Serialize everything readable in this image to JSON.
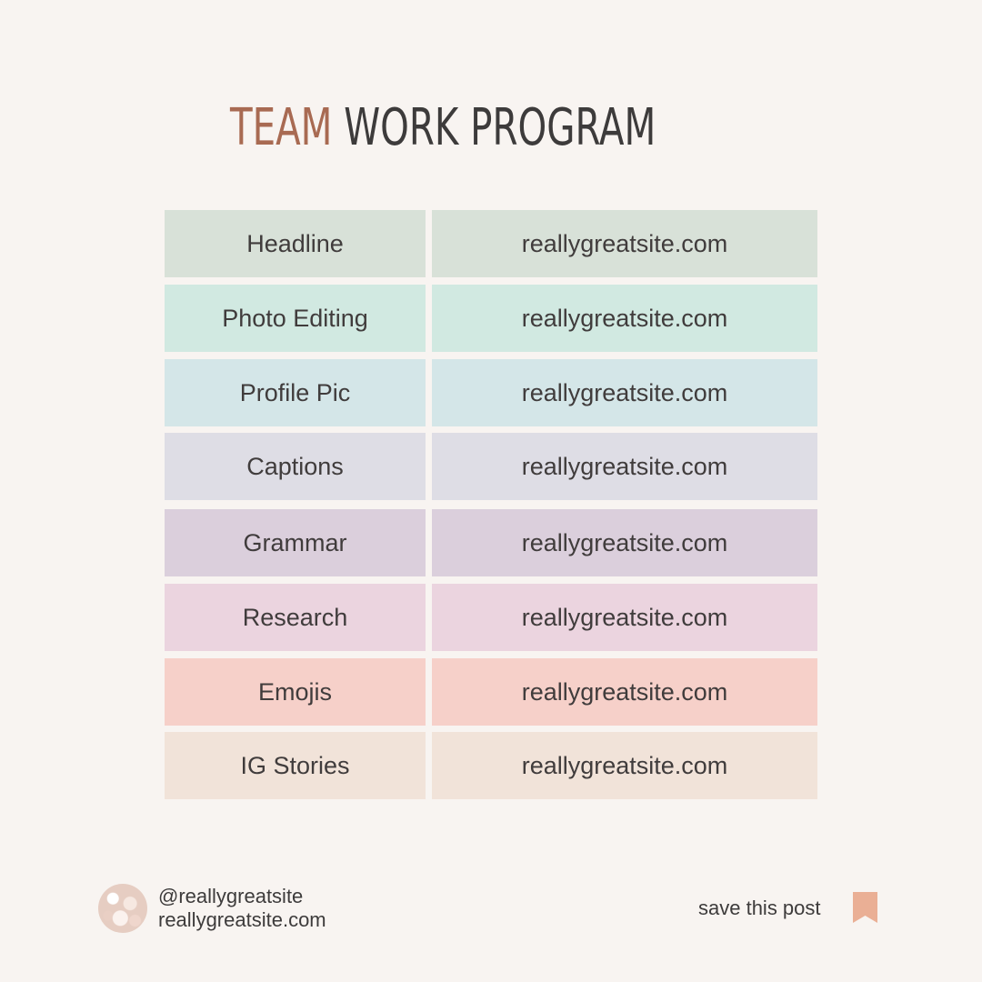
{
  "title": {
    "accent": "TEAM",
    "rest": "WORK PROGRAM"
  },
  "colors": {
    "accent": "#a86a52",
    "text": "#3d3b3b",
    "background": "#f8f4f1",
    "bookmark": "#eaaf95"
  },
  "rows": [
    {
      "label": "Headline",
      "link": "reallygreatsite.com",
      "color": "#d8e1d8"
    },
    {
      "label": "Photo Editing",
      "link": "reallygreatsite.com",
      "color": "#d1e9e1"
    },
    {
      "label": "Profile Pic",
      "link": "reallygreatsite.com",
      "color": "#d4e6e8"
    },
    {
      "label": "Captions",
      "link": "reallygreatsite.com",
      "color": "#dedde5"
    },
    {
      "label": "Grammar",
      "link": "reallygreatsite.com",
      "color": "#dbcfdc"
    },
    {
      "label": "Research",
      "link": "reallygreatsite.com",
      "color": "#ebd4df"
    },
    {
      "label": "Emojis",
      "link": "reallygreatsite.com",
      "color": "#f6d0c9"
    },
    {
      "label": "IG Stories",
      "link": "reallygreatsite.com",
      "color": "#f1e3d9"
    }
  ],
  "footer": {
    "handle": "@reallygreatsite",
    "site": "reallygreatsite.com",
    "save_label": "save this post",
    "avatar_icon": "flower-photo-avatar",
    "bookmark_icon": "bookmark-icon"
  }
}
